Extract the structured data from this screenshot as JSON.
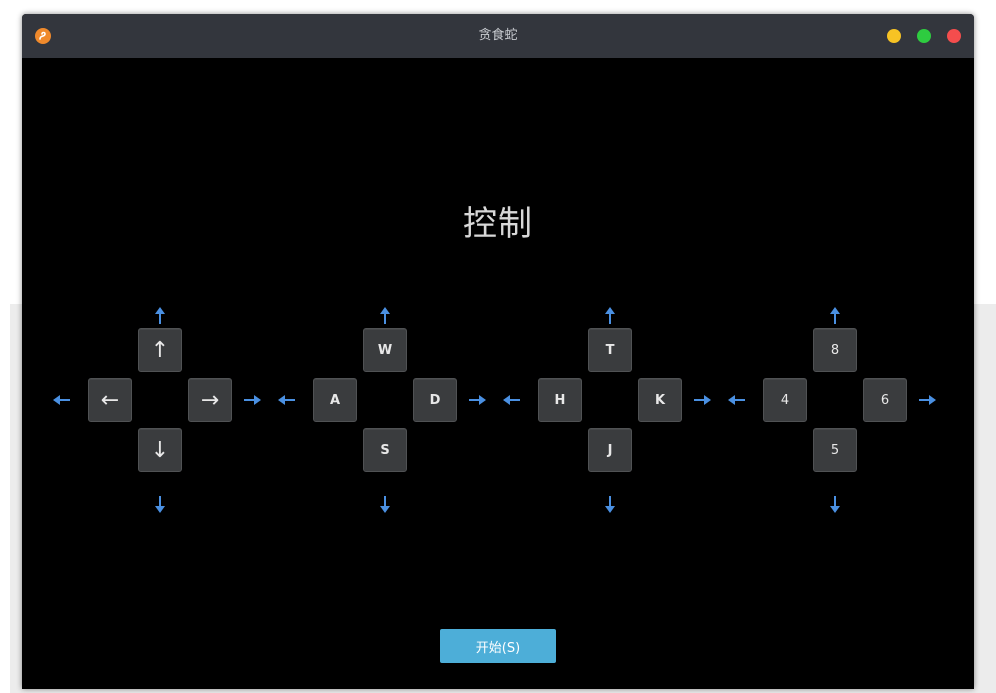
{
  "window": {
    "title": "贪食蛇",
    "app_icon": "snake-app-icon",
    "controls": [
      "minimize",
      "maximize",
      "close"
    ]
  },
  "main": {
    "heading": "控制",
    "key_groups": [
      {
        "name": "arrow-keys",
        "up": "↑",
        "left": "←",
        "right": "→",
        "down": "↓"
      },
      {
        "name": "wasd-keys",
        "up": "W",
        "left": "A",
        "right": "D",
        "down": "S"
      },
      {
        "name": "thkj-keys",
        "up": "T",
        "left": "H",
        "right": "K",
        "down": "J"
      },
      {
        "name": "numpad-keys",
        "up": "8",
        "left": "4",
        "right": "6",
        "down": "5"
      }
    ],
    "start_button": "开始(S)"
  },
  "colors": {
    "accent_arrow": "#4a90e2",
    "start_button": "#4daed8",
    "titlebar": "#33363d"
  }
}
